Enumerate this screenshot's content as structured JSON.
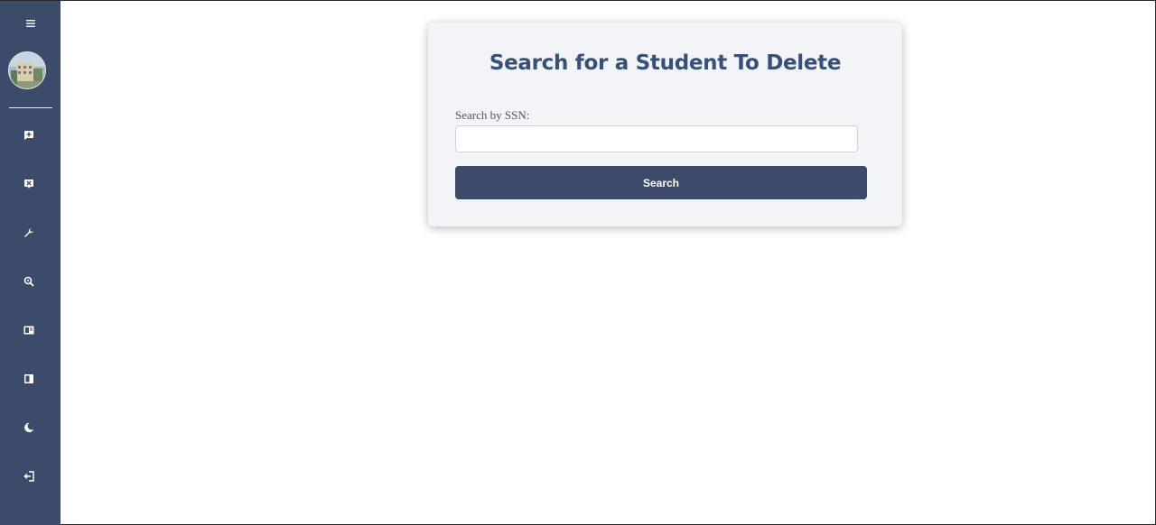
{
  "sidebar": {
    "items": [
      {
        "icon": "add-comment-icon"
      },
      {
        "icon": "delete-box-icon"
      },
      {
        "icon": "wrench-icon"
      },
      {
        "icon": "search-icon"
      },
      {
        "icon": "id-card-icon"
      },
      {
        "icon": "book-icon"
      },
      {
        "icon": "moon-icon"
      },
      {
        "icon": "logout-icon"
      }
    ]
  },
  "card": {
    "title": "Search for a Student To Delete",
    "label": "Search by SSN:",
    "input_value": "",
    "input_placeholder": "",
    "button_label": "Search"
  },
  "colors": {
    "sidebar": "#3d4b6b",
    "accent": "#35507a",
    "card_bg": "#f2f4f8"
  }
}
